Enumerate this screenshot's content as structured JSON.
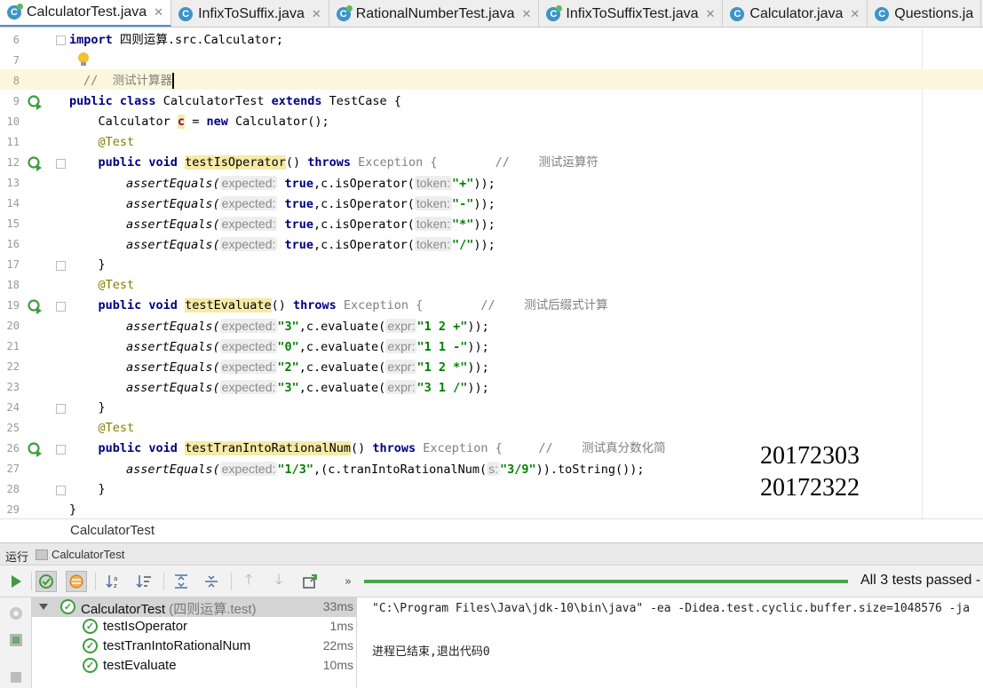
{
  "tabs": [
    {
      "label": "CalculatorTest.java",
      "active": true,
      "icon": "class-test-icon"
    },
    {
      "label": "InfixToSuffix.java",
      "active": false,
      "icon": "class-icon"
    },
    {
      "label": "RationalNumberTest.java",
      "active": false,
      "icon": "class-test-icon"
    },
    {
      "label": "InfixToSuffixTest.java",
      "active": false,
      "icon": "class-test-icon"
    },
    {
      "label": "Calculator.java",
      "active": false,
      "icon": "class-icon"
    },
    {
      "label": "Questions.ja",
      "active": false,
      "icon": "class-icon"
    }
  ],
  "editor": {
    "line_numbers": [
      "6",
      "7",
      "8",
      "9",
      "10",
      "11",
      "12",
      "13",
      "14",
      "15",
      "16",
      "17",
      "18",
      "19",
      "20",
      "21",
      "22",
      "23",
      "24",
      "25",
      "26",
      "27",
      "28",
      "29"
    ],
    "code": {
      "l6_kw": "import",
      "l6_rest": " 四则运算.src.Calculator;",
      "l8_comment": "//  测试计算器",
      "l9_kw1": "public",
      "l9_kw2": "class",
      "l9_name": " CalculatorTest ",
      "l9_kw3": "extends",
      "l9_rest": " TestCase {",
      "l10_a": "    Calculator ",
      "l10_var": "c",
      "l10_b": " = ",
      "l10_kw": "new",
      "l10_c": " Calculator();",
      "l11_ann": "    @Test",
      "l12_kw1": "    public",
      "l12_kw2": " void ",
      "l12_meth": "testIsOperator",
      "l12_b": "() ",
      "l12_kw3": "throws",
      "l12_exc": " Exception {",
      "l12_cmt": "        //    测试运算符",
      "assert": "assertEquals(",
      "hint_expected": "expected:",
      "hint_token": "token:",
      "hint_expr": "expr:",
      "hint_s": "s:",
      "true": "true",
      "isop": ",c.isOperator(",
      "eval": ",c.evaluate(",
      "close": "));",
      "op_plus": "\"+\"",
      "op_minus": "\"-\"",
      "op_mul": "\"*\"",
      "op_div": "\"/\"",
      "brace": "    }",
      "l18_ann": "    @Test",
      "l19_meth": "testEvaluate",
      "l19_cmt": "        //    测试后缀式计算",
      "e20_exp": "\"3\"",
      "e20_arg": "\"1 2 +\"",
      "e21_exp": "\"0\"",
      "e21_arg": "\"1 1 -\"",
      "e22_exp": "\"2\"",
      "e22_arg": "\"1 2 *\"",
      "e23_exp": "\"3\"",
      "e23_arg": "\"3 1 /\"",
      "l25_ann": "    @Test",
      "l26_meth": "testTranIntoRationalNum",
      "l26_cmt": "     //    测试真分数化简",
      "l27_exp": "\"1/3\"",
      "l27_mid": ",(c.tranIntoRationalNum(",
      "l27_arg": "\"3/9\"",
      "l27_end": ")).toString());",
      "l29": "}"
    },
    "stamp_numbers": [
      "20172303",
      "20172322"
    ],
    "breadcrumb": "CalculatorTest"
  },
  "run_panel": {
    "label": "运行",
    "tab": "CalculatorTest",
    "status": "All 3 tests passed - ",
    "progress": 1.0,
    "tree": [
      {
        "name": "CalculatorTest",
        "pkg": " (四则运算.test)",
        "time": "33ms"
      },
      {
        "name": "testIsOperator",
        "time": "1ms"
      },
      {
        "name": "testTranIntoRationalNum",
        "time": "22ms"
      },
      {
        "name": "testEvaluate",
        "time": "10ms"
      }
    ],
    "console": [
      "\"C:\\Program Files\\Java\\jdk-10\\bin\\java\" -ea -Didea.test.cyclic.buffer.size=1048576 -ja",
      "进程已结束,退出代码0"
    ]
  },
  "colors": {
    "pass": "#3f9b3f",
    "accent": "#4d8ad6",
    "line_highlight": "#fcf6dc"
  }
}
